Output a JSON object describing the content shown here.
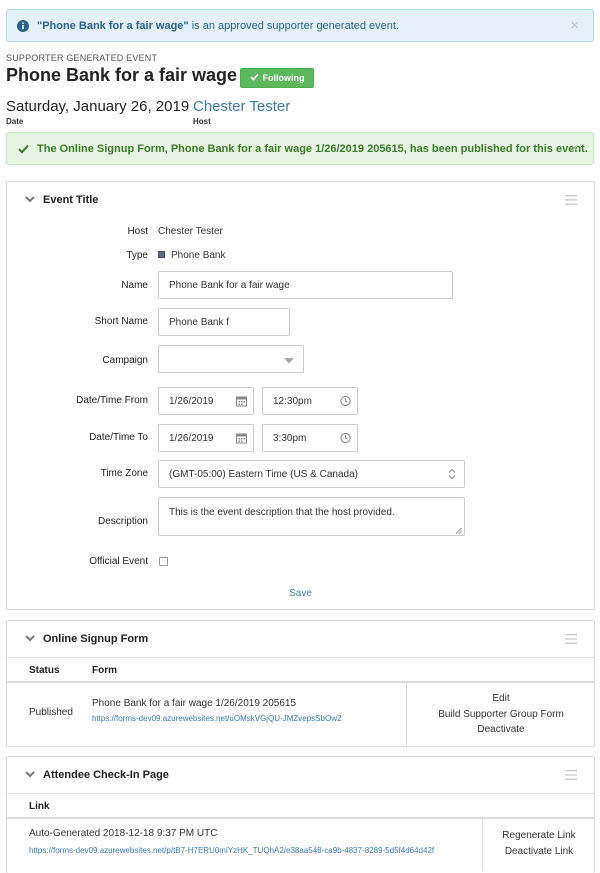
{
  "alerts": {
    "approved": {
      "event_name": "\"Phone Bank for a fair wage\"",
      "message": " is an approved supporter generated event.",
      "close": "×"
    },
    "published": {
      "message": "The Online Signup Form, Phone Bank for a fair wage 1/26/2019 205615, has been published for this event.",
      "close": "×"
    }
  },
  "header": {
    "label": "SUPPORTER GENERATED EVENT",
    "title": "Phone Bank for a fair wage",
    "follow_label": "Following",
    "date": "Saturday, January 26, 2019",
    "date_caption": "Date",
    "host": "Chester Tester",
    "host_caption": "Host"
  },
  "event_panel": {
    "title": "Event Title",
    "fields": {
      "host_label": "Host",
      "host_value": "Chester Tester",
      "type_label": "Type",
      "type_value": "Phone Bank",
      "name_label": "Name",
      "name_value": "Phone Bank for a fair wage",
      "short_name_label": "Short Name",
      "short_name_value": "Phone Bank f",
      "campaign_label": "Campaign",
      "campaign_value": "",
      "from_label": "Date/Time From",
      "from_date": "1/26/2019",
      "from_time": "12:30pm",
      "to_label": "Date/Time To",
      "to_date": "1/26/2019",
      "to_time": "3:30pm",
      "timezone_label": "Time Zone",
      "timezone_value": "(GMT-05:00) Eastern Time (US & Canada)",
      "description_label": "Description",
      "description_value": "This is the event description that the host provided.",
      "official_label": "Official Event",
      "official_checked": false
    },
    "save_label": "Save"
  },
  "signup_panel": {
    "title": "Online Signup Form",
    "columns": [
      "Status",
      "Form"
    ],
    "row": {
      "status": "Published",
      "form_name": "Phone Bank for a fair wage 1/26/2019 205615",
      "form_url": "https://forms-dev09.azurewebsites.net/uOMskVGjQU-JMZvepsSbOw2",
      "actions": [
        "Edit",
        "Build Supporter Group Form",
        "Deactivate"
      ]
    }
  },
  "attendee_panel": {
    "title": "Attendee Check-In Page",
    "columns": [
      "Link"
    ],
    "row": {
      "generated": "Auto-Generated 2018-12-18 9:37 PM UTC",
      "url": "https://forms-dev09.azurewebsites.net/p/tB7-H7ERU0miYzHK_TUQhA2/e38aa548-ca9b-4837-8289-5d5f4d64d42f",
      "actions": [
        "Regenerate Link",
        "Deactivate Link"
      ]
    }
  },
  "colors": {
    "link": "#3a7ab8",
    "success": "#5cb85c",
    "info_bg": "#e4f1fa",
    "success_bg": "#e7f6e2"
  }
}
